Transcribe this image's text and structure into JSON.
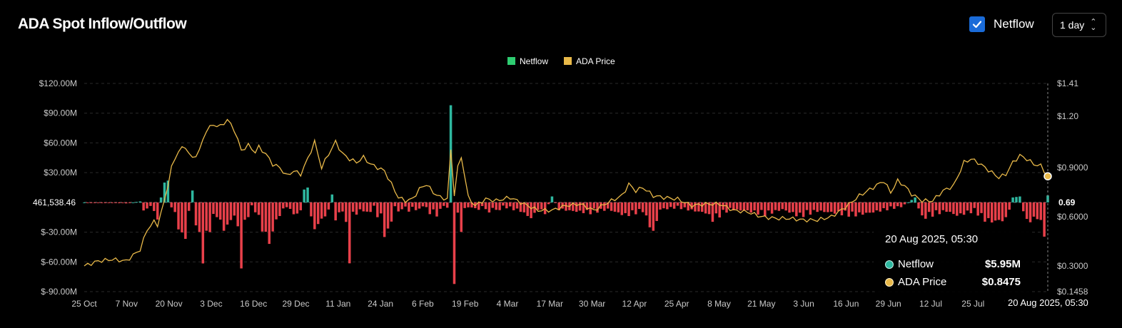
{
  "title": "ADA Spot Inflow/Outflow",
  "controls": {
    "netflow_label": "Netflow",
    "netflow_checked": true,
    "range_label": "1 day"
  },
  "colors": {
    "positive": "#2eb8a0",
    "negative": "#e8404a",
    "price": "#e9b949",
    "legend_netflow": "#2ecc71",
    "check": "#1a6bd8"
  },
  "tooltip": {
    "date": "20 Aug 2025, 05:30",
    "netflow_label": "Netflow",
    "netflow_value": "$5.95M",
    "price_label": "ADA Price",
    "price_value": "$0.8475"
  },
  "chart_data": {
    "type": "bar+line",
    "legend": [
      "Netflow",
      "ADA Price"
    ],
    "y_left": {
      "min": -90000000,
      "max": 120000000,
      "ticks": [
        "$120.00M",
        "$90.00M",
        "$60.00M",
        "$30.00M",
        "$-30.00M",
        "$-60.00M",
        "$-90.00M"
      ],
      "tick_values": [
        120000000,
        90000000,
        60000000,
        30000000,
        -30000000,
        -60000000,
        -90000000
      ]
    },
    "y_right": {
      "ticks": [
        "$1.41",
        "$1.20",
        "$0.9000",
        "$0.6000",
        "$0.3000",
        "$0.1458"
      ],
      "tick_values": [
        1.41,
        1.2,
        0.9,
        0.6,
        0.3,
        0.1458
      ],
      "current_label": "0.69",
      "current_value": 0.69
    },
    "zero_label": "461,538.46",
    "x_labels": [
      "25 Oct",
      "7 Nov",
      "20 Nov",
      "3 Dec",
      "16 Dec",
      "29 Dec",
      "11 Jan",
      "24 Jan",
      "6 Feb",
      "19 Feb",
      "4 Mar",
      "17 Mar",
      "30 Mar",
      "12 Apr",
      "25 Apr",
      "8 May",
      "21 May",
      "3 Jun",
      "16 Jun",
      "29 Jun",
      "12 Jul",
      "25 Jul",
      "7 Aug"
    ],
    "hover_x_label": "20 Aug 2025, 05:30",
    "netflow_keypoints_M": [
      [
        0,
        0
      ],
      [
        12,
        -1
      ],
      [
        16,
        1
      ],
      [
        17,
        -10
      ],
      [
        19,
        -4
      ],
      [
        21,
        -18
      ],
      [
        22,
        5
      ],
      [
        23,
        20
      ],
      [
        24,
        22
      ],
      [
        25,
        -5
      ],
      [
        26,
        -15
      ],
      [
        27,
        -28
      ],
      [
        28,
        -40
      ],
      [
        29,
        -40
      ],
      [
        30,
        -10
      ],
      [
        31,
        12
      ],
      [
        32,
        -25
      ],
      [
        33,
        -40
      ],
      [
        34,
        -63
      ],
      [
        35,
        -45
      ],
      [
        36,
        -30
      ],
      [
        37,
        -20
      ],
      [
        38,
        -15
      ],
      [
        39,
        -25
      ],
      [
        40,
        -30
      ],
      [
        41,
        -28
      ],
      [
        42,
        -20
      ],
      [
        43,
        -15
      ],
      [
        44,
        -30
      ],
      [
        45,
        -70
      ],
      [
        46,
        -25
      ],
      [
        47,
        -15
      ],
      [
        48,
        -5
      ],
      [
        49,
        -10
      ],
      [
        50,
        -20
      ],
      [
        51,
        -30
      ],
      [
        52,
        -40
      ],
      [
        53,
        -45
      ],
      [
        54,
        -35
      ],
      [
        55,
        -20
      ],
      [
        56,
        -15
      ],
      [
        57,
        -8
      ],
      [
        58,
        -5
      ],
      [
        59,
        -10
      ],
      [
        60,
        -12
      ],
      [
        61,
        -20
      ],
      [
        62,
        -8
      ],
      [
        63,
        13
      ],
      [
        64,
        15
      ],
      [
        65,
        -18
      ],
      [
        66,
        -30
      ],
      [
        67,
        -25
      ],
      [
        68,
        -20
      ],
      [
        69,
        -15
      ],
      [
        70,
        -10
      ],
      [
        71,
        8
      ],
      [
        72,
        -30
      ],
      [
        73,
        -10
      ],
      [
        74,
        -15
      ],
      [
        75,
        -20
      ],
      [
        76,
        -85
      ],
      [
        77,
        -10
      ],
      [
        78,
        -15
      ],
      [
        79,
        -8
      ],
      [
        80,
        -10
      ],
      [
        81,
        -12
      ],
      [
        82,
        -10
      ],
      [
        83,
        -5
      ],
      [
        84,
        -15
      ],
      [
        85,
        -20
      ],
      [
        86,
        -35
      ],
      [
        87,
        -40
      ],
      [
        88,
        -20
      ],
      [
        89,
        -5
      ],
      [
        90,
        -10
      ],
      [
        91,
        -8
      ],
      [
        92,
        -5
      ],
      [
        93,
        -10
      ],
      [
        94,
        -6
      ],
      [
        95,
        -8
      ],
      [
        96,
        -10
      ],
      [
        97,
        -4
      ],
      [
        98,
        -8
      ],
      [
        99,
        -12
      ],
      [
        100,
        -10
      ],
      [
        101,
        -15
      ],
      [
        102,
        -8
      ],
      [
        103,
        -4
      ],
      [
        104,
        -6
      ],
      [
        105,
        98
      ],
      [
        106,
        -86
      ],
      [
        107,
        -15
      ],
      [
        108,
        -30
      ],
      [
        109,
        -10
      ],
      [
        110,
        -5
      ],
      [
        111,
        -8
      ],
      [
        112,
        -6
      ],
      [
        113,
        -10
      ],
      [
        114,
        -4
      ],
      [
        115,
        -8
      ],
      [
        116,
        -12
      ],
      [
        117,
        -6
      ],
      [
        118,
        -10
      ],
      [
        119,
        -8
      ],
      [
        120,
        -5
      ],
      [
        125,
        -10
      ],
      [
        128,
        -18
      ],
      [
        130,
        -8
      ],
      [
        132,
        -12
      ],
      [
        134,
        6
      ],
      [
        136,
        -8
      ],
      [
        140,
        -10
      ],
      [
        145,
        -12
      ],
      [
        150,
        -8
      ],
      [
        155,
        -15
      ],
      [
        160,
        -10
      ],
      [
        163,
        -35
      ],
      [
        165,
        -8
      ],
      [
        170,
        -6
      ],
      [
        175,
        -10
      ],
      [
        178,
        -12
      ],
      [
        180,
        -20
      ],
      [
        185,
        -8
      ],
      [
        190,
        -10
      ],
      [
        195,
        -14
      ],
      [
        200,
        -8
      ],
      [
        205,
        -16
      ],
      [
        210,
        -10
      ],
      [
        215,
        -12
      ],
      [
        220,
        -15
      ],
      [
        225,
        -12
      ],
      [
        230,
        -8
      ],
      [
        234,
        -5
      ],
      [
        238,
        5
      ],
      [
        240,
        -18
      ],
      [
        245,
        -12
      ],
      [
        247,
        -10
      ],
      [
        250,
        -15
      ],
      [
        255,
        -10
      ],
      [
        258,
        -20
      ],
      [
        260,
        -22
      ],
      [
        264,
        -20
      ],
      [
        266,
        5
      ],
      [
        268,
        6
      ],
      [
        270,
        -24
      ],
      [
        272,
        -18
      ],
      [
        274,
        -20
      ],
      [
        275,
        -43
      ],
      [
        276,
        7
      ]
    ],
    "price_keypoints": [
      [
        0,
        0.3
      ],
      [
        4,
        0.33
      ],
      [
        8,
        0.34
      ],
      [
        12,
        0.33
      ],
      [
        16,
        0.4
      ],
      [
        18,
        0.52
      ],
      [
        20,
        0.57
      ],
      [
        21,
        0.55
      ],
      [
        23,
        0.7
      ],
      [
        25,
        0.9
      ],
      [
        27,
        1.0
      ],
      [
        29,
        1.02
      ],
      [
        31,
        0.95
      ],
      [
        33,
        1.0
      ],
      [
        35,
        1.12
      ],
      [
        37,
        1.15
      ],
      [
        39,
        1.14
      ],
      [
        41,
        1.18
      ],
      [
        43,
        1.12
      ],
      [
        45,
        1.0
      ],
      [
        47,
        1.03
      ],
      [
        49,
        0.99
      ],
      [
        50,
        1.02
      ],
      [
        52,
        0.98
      ],
      [
        54,
        0.92
      ],
      [
        56,
        0.9
      ],
      [
        58,
        0.85
      ],
      [
        60,
        0.88
      ],
      [
        62,
        0.86
      ],
      [
        64,
        0.95
      ],
      [
        66,
        1.05
      ],
      [
        68,
        0.9
      ],
      [
        70,
        0.98
      ],
      [
        72,
        1.05
      ],
      [
        74,
        0.98
      ],
      [
        76,
        0.95
      ],
      [
        78,
        0.93
      ],
      [
        80,
        0.96
      ],
      [
        82,
        0.92
      ],
      [
        84,
        0.9
      ],
      [
        86,
        0.88
      ],
      [
        88,
        0.8
      ],
      [
        90,
        0.72
      ],
      [
        92,
        0.7
      ],
      [
        94,
        0.71
      ],
      [
        96,
        0.77
      ],
      [
        98,
        0.8
      ],
      [
        100,
        0.75
      ],
      [
        102,
        0.72
      ],
      [
        104,
        0.71
      ],
      [
        105,
        1.0
      ],
      [
        106,
        0.74
      ],
      [
        107,
        0.9
      ],
      [
        108,
        0.96
      ],
      [
        109,
        0.85
      ],
      [
        110,
        0.72
      ],
      [
        112,
        0.67
      ],
      [
        115,
        0.71
      ],
      [
        118,
        0.7
      ],
      [
        122,
        0.72
      ],
      [
        126,
        0.68
      ],
      [
        130,
        0.64
      ],
      [
        134,
        0.64
      ],
      [
        138,
        0.67
      ],
      [
        142,
        0.68
      ],
      [
        146,
        0.64
      ],
      [
        150,
        0.69
      ],
      [
        154,
        0.73
      ],
      [
        156,
        0.8
      ],
      [
        158,
        0.76
      ],
      [
        160,
        0.78
      ],
      [
        163,
        0.73
      ],
      [
        166,
        0.72
      ],
      [
        170,
        0.71
      ],
      [
        174,
        0.67
      ],
      [
        178,
        0.68
      ],
      [
        182,
        0.68
      ],
      [
        186,
        0.64
      ],
      [
        190,
        0.63
      ],
      [
        194,
        0.6
      ],
      [
        198,
        0.59
      ],
      [
        202,
        0.59
      ],
      [
        206,
        0.58
      ],
      [
        210,
        0.58
      ],
      [
        214,
        0.6
      ],
      [
        218,
        0.66
      ],
      [
        222,
        0.73
      ],
      [
        226,
        0.78
      ],
      [
        229,
        0.82
      ],
      [
        231,
        0.75
      ],
      [
        233,
        0.82
      ],
      [
        235,
        0.79
      ],
      [
        237,
        0.74
      ],
      [
        240,
        0.7
      ],
      [
        243,
        0.7
      ],
      [
        246,
        0.76
      ],
      [
        249,
        0.79
      ],
      [
        252,
        0.93
      ],
      [
        254,
        0.95
      ],
      [
        256,
        0.93
      ],
      [
        258,
        0.9
      ],
      [
        260,
        0.87
      ],
      [
        262,
        0.84
      ],
      [
        264,
        0.86
      ],
      [
        266,
        0.93
      ],
      [
        268,
        0.97
      ],
      [
        270,
        0.95
      ],
      [
        272,
        0.92
      ],
      [
        274,
        0.91
      ],
      [
        276,
        0.8475
      ]
    ],
    "n_points": 277
  }
}
